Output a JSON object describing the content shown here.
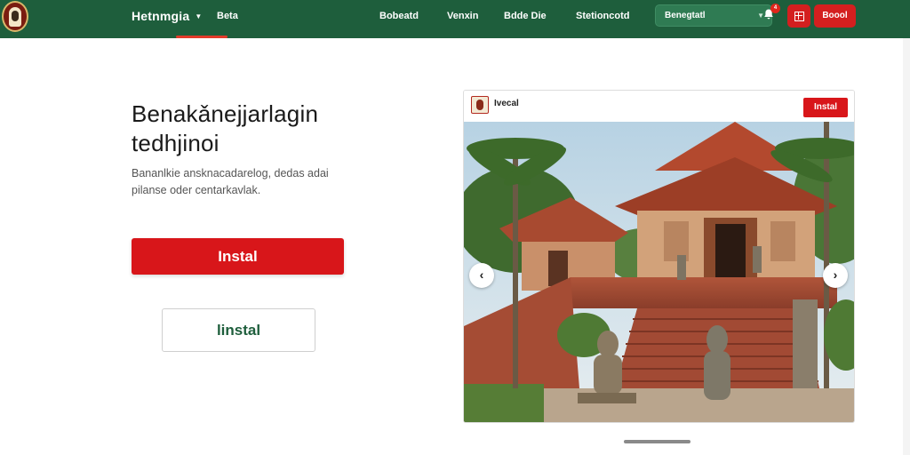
{
  "header": {
    "brand": "Hetnmgia",
    "brand_sub": "Beta",
    "nav": [
      "Bobeatd",
      "Venxin",
      "Bdde Die",
      "Stetioncotd"
    ],
    "search_label": "Benegtatl",
    "notification_count": "4",
    "cta_label": "Boool"
  },
  "hero": {
    "headline": "Benakǎnejjarlagin tedhjinoi",
    "subtext": "Bananlkie ansknacadarelog, dedas adai pilanse oder centarkavlak.",
    "primary_button": "Instal",
    "secondary_button": "linstal"
  },
  "card": {
    "title": "Ivecal",
    "button": "Instal",
    "prev_arrow": "‹",
    "next_arrow": "›"
  },
  "colors": {
    "nav_bg": "#1e5e3c",
    "accent_red": "#d8161a",
    "accent_green": "#1e5e3c"
  },
  "icons": {
    "logo": "logo-icon",
    "brand_caret": "chevron-down-icon",
    "search_caret": "chevron-down-icon",
    "bell": "bell-icon",
    "grid": "grid-icon",
    "prev": "chevron-left-icon",
    "next": "chevron-right-icon"
  }
}
